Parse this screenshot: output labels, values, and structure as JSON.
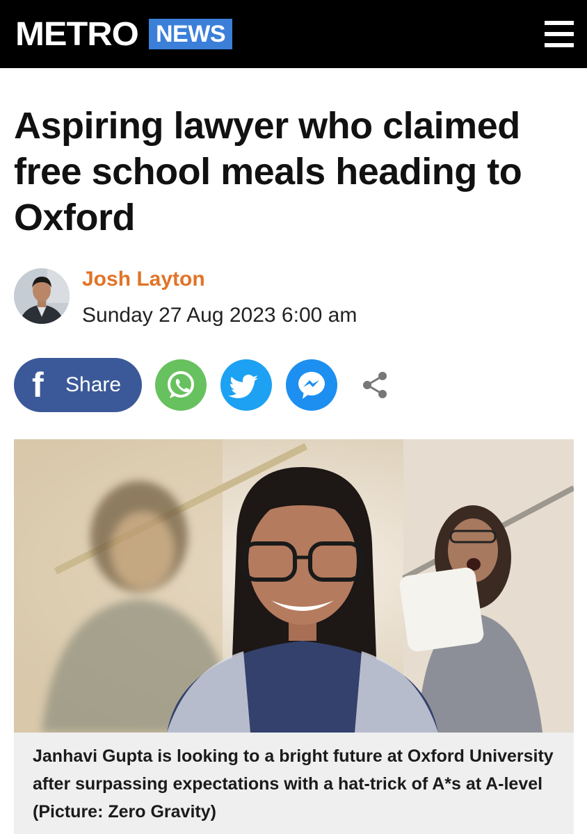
{
  "header": {
    "logo": "METRO",
    "section": "NEWS",
    "menu_icon": "hamburger-menu-icon",
    "colors": {
      "background": "#000000",
      "section_badge": "#3b7fd9"
    }
  },
  "article": {
    "headline": "Aspiring lawyer who claimed free school meals heading to Oxford",
    "author": "Josh Layton",
    "date": "Sunday 27 Aug 2023 6:00 am",
    "author_color": "#e07427"
  },
  "share": {
    "facebook_label": "Share",
    "icons": [
      "facebook-icon",
      "whatsapp-icon",
      "twitter-icon",
      "messenger-icon",
      "share-icon"
    ],
    "colors": {
      "facebook": "#3b5998",
      "whatsapp": "#67c15e",
      "twitter": "#1da1f2",
      "messenger": "#1d8ff0"
    }
  },
  "image": {
    "caption": "Janhavi Gupta is looking to a bright future at Oxford University after surpassing expectations with a hat-trick of A*s at A-level (Picture: Zero Gravity)"
  }
}
